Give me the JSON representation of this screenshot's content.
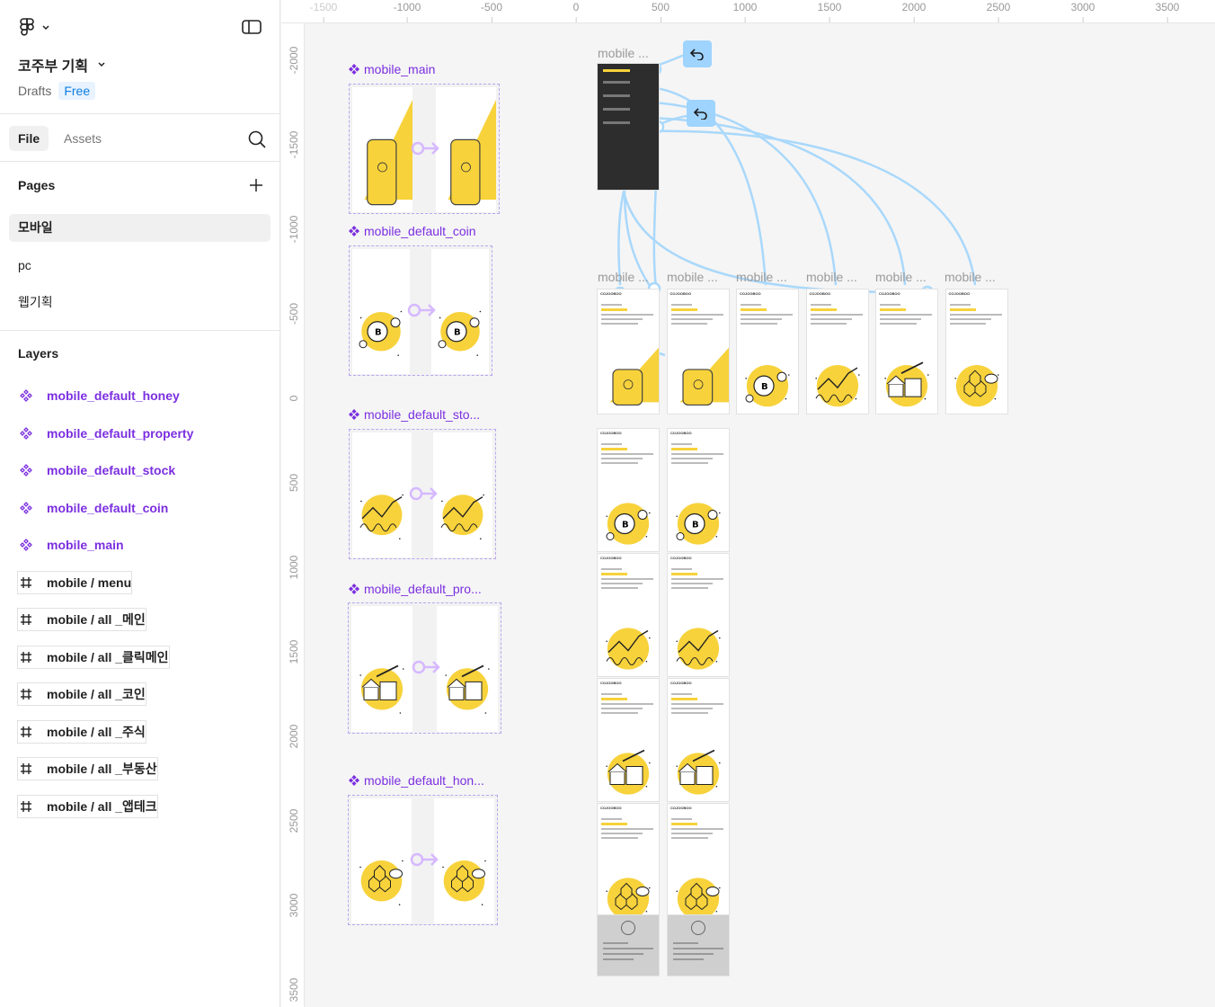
{
  "sidebar": {
    "project_title": "코주부 기획",
    "location": "Drafts",
    "plan_badge": "Free",
    "tabs": {
      "file": "File",
      "assets": "Assets"
    },
    "pages_heading": "Pages",
    "pages": [
      "모바일",
      "pc",
      "웹기획"
    ],
    "layers_heading": "Layers",
    "layers": [
      {
        "label": "mobile_default_honey",
        "kind": "component"
      },
      {
        "label": "mobile_default_property",
        "kind": "component"
      },
      {
        "label": "mobile_default_stock",
        "kind": "component"
      },
      {
        "label": "mobile_default_coin",
        "kind": "component"
      },
      {
        "label": "mobile_main",
        "kind": "component"
      },
      {
        "label": "mobile / menu",
        "kind": "frame"
      },
      {
        "label": "mobile / all _메인",
        "kind": "frame"
      },
      {
        "label": "mobile / all _클릭메인",
        "kind": "frame"
      },
      {
        "label": "mobile / all _코인",
        "kind": "frame"
      },
      {
        "label": "mobile / all _주식",
        "kind": "frame"
      },
      {
        "label": "mobile / all _부동산",
        "kind": "frame"
      },
      {
        "label": "mobile / all _앱테크",
        "kind": "frame"
      }
    ]
  },
  "rulers": {
    "top": [
      "-1500",
      "-1000",
      "-500",
      "0",
      "500",
      "1000",
      "1500",
      "2000",
      "2500",
      "3000",
      "3500"
    ],
    "left": [
      "-2000",
      "-1500",
      "-1000",
      "-500",
      "0",
      "500",
      "1000",
      "1500",
      "2000",
      "2500",
      "3000",
      "3500"
    ]
  },
  "canvas": {
    "components": [
      {
        "label": "mobile_main"
      },
      {
        "label": "mobile_default_coin"
      },
      {
        "label": "mobile_default_sto..."
      },
      {
        "label": "mobile_default_pro..."
      },
      {
        "label": "mobile_default_hon..."
      }
    ],
    "frame_labels": [
      "mobile ...",
      "mobile ...",
      "mobile ...",
      "mobile ...",
      "mobile ...",
      "mobile ...",
      "mobile ..."
    ],
    "frame_brand": "COJOOBOO",
    "frame_headlines": [
      "세상의 모든",
      "코인 정보를 제공!",
      "주식 정보를 제공!",
      "부동산 정보를 제공!",
      "앱테크&꿀알바 정보를 제공!"
    ],
    "brand_color": "#f7d23b",
    "component_color": "#7b2fe0",
    "prototype_color": "#9fd4ff"
  }
}
